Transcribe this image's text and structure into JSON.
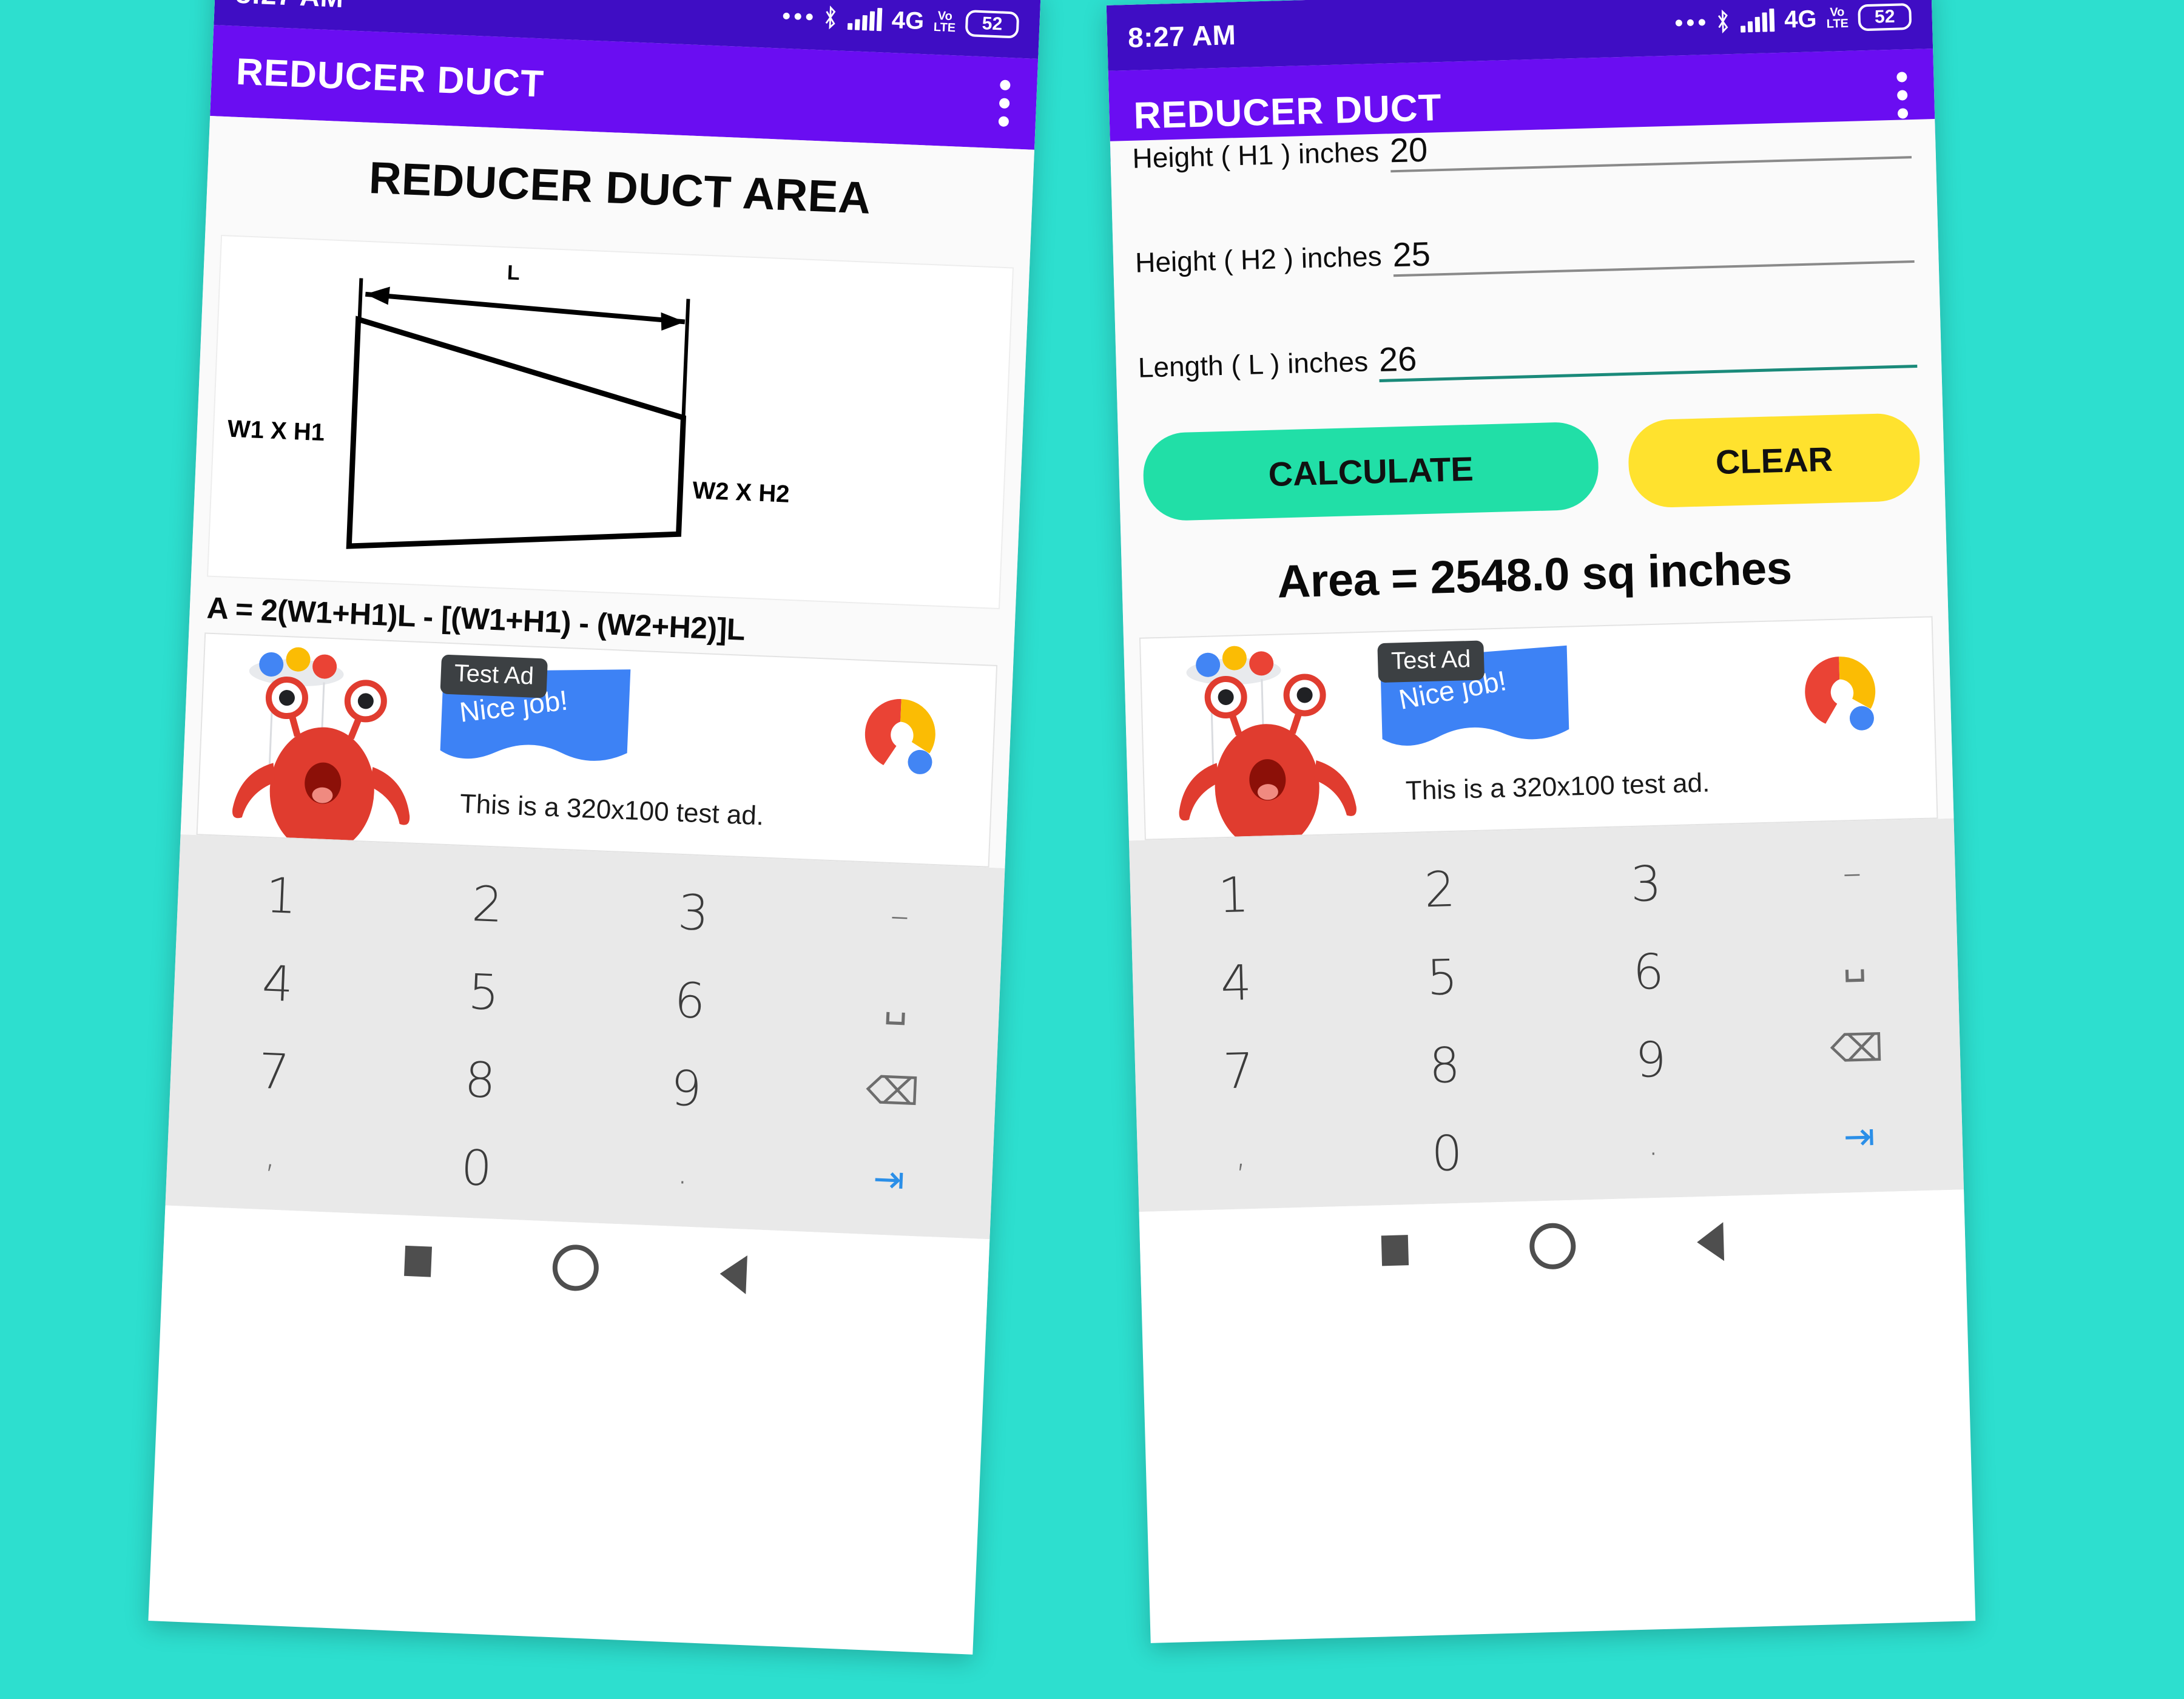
{
  "background_color": "#2ddfcf",
  "theme": {
    "status_bar": "#3f0dc4",
    "app_bar": "#6a0df2",
    "calculate_button": "#21dfa7",
    "clear_button": "#ffe22e",
    "focused_underline": "#1a8a7a",
    "keyboard_bg": "#e9e9e9"
  },
  "status_bar": {
    "time": "8:27 AM",
    "icons": [
      "more-dots-icon",
      "bluetooth-icon",
      "signal-bars-icon",
      "volte-icon"
    ],
    "network": "4G",
    "volte_top": "Vo",
    "volte_bottom": "LTE",
    "battery": "52"
  },
  "app_bar": {
    "title": "REDUCER DUCT",
    "overflow_icon": "kebab-menu-icon"
  },
  "left_screen": {
    "page_title": "REDUCER DUCT AREA",
    "diagram": {
      "length_label": "L",
      "inlet_label": "W1 X H1",
      "outlet_label": "W2 X H2"
    },
    "formula": "A = 2(W1+H1)L -  [(W1+H1) - (W2+H2)]L"
  },
  "right_screen": {
    "fields": [
      {
        "label": "Height ( H1 ) inches",
        "value": "20",
        "focused": false
      },
      {
        "label": "Height ( H2 ) inches",
        "value": "25",
        "focused": false
      },
      {
        "label": "Length ( L ) inches",
        "value": "26",
        "focused": true
      }
    ],
    "calculate_label": "CALCULATE",
    "clear_label": "CLEAR",
    "result": "Area = 2548.0 sq inches"
  },
  "ad": {
    "badge": "Test Ad",
    "banner_text": "Nice job!",
    "body_text": "This is a 320x100 test ad.",
    "logo": "admob-logo-icon",
    "mascot": "red-monster-icon"
  },
  "keyboard": {
    "rows": [
      [
        "1",
        "2",
        "3",
        "–"
      ],
      [
        "4",
        "5",
        "6",
        "␣"
      ],
      [
        "7",
        "8",
        "9",
        "⌫"
      ],
      [
        ",",
        "0",
        ".",
        "⇥"
      ]
    ]
  },
  "nav_bar": {
    "recent": "square-recents-icon",
    "home": "circle-home-icon",
    "back": "triangle-back-icon"
  }
}
